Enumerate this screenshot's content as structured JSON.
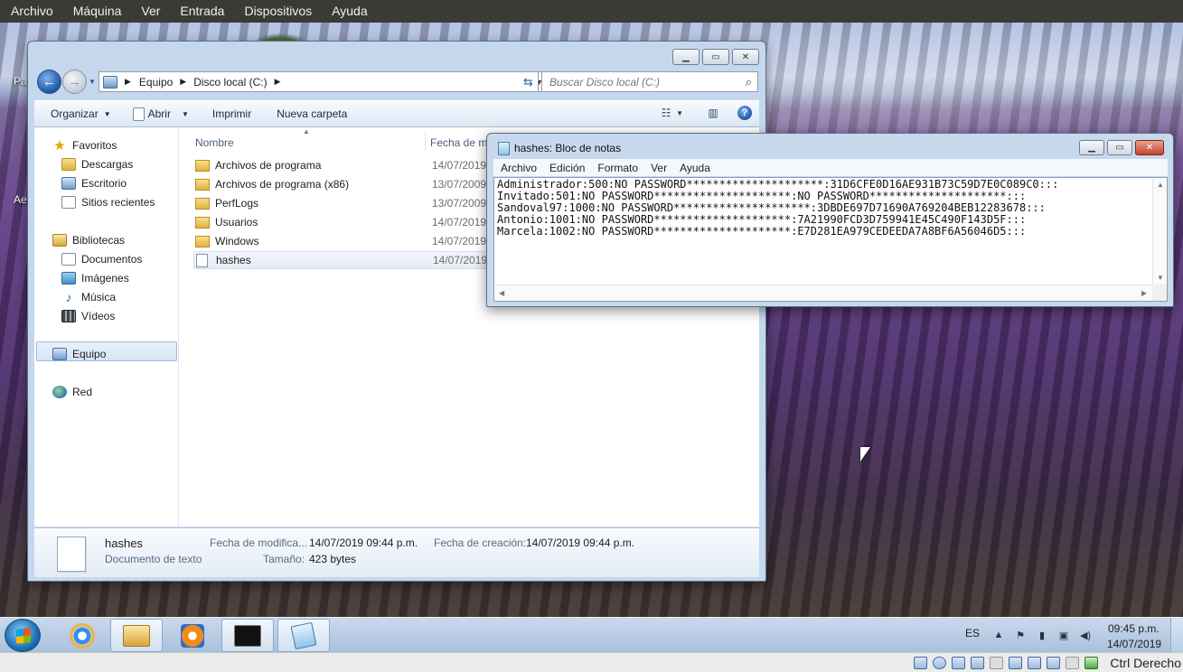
{
  "vbox": {
    "menu": [
      "Archivo",
      "Máquina",
      "Ver",
      "Entrada",
      "Dispositivos",
      "Ayuda"
    ],
    "host_key": "Ctrl Derecho"
  },
  "desktop": {
    "icon_fragments": [
      "Pa",
      "Aer"
    ]
  },
  "explorer": {
    "breadcrumb": [
      "Equipo",
      "Disco local (C:)"
    ],
    "search_placeholder": "Buscar Disco local (C:)",
    "toolbar": {
      "organize": "Organizar",
      "open": "Abrir",
      "print": "Imprimir",
      "new_folder": "Nueva carpeta"
    },
    "nav": {
      "favorites": "Favoritos",
      "downloads": "Descargas",
      "desktop": "Escritorio",
      "recent": "Sitios recientes",
      "libraries": "Bibliotecas",
      "documents": "Documentos",
      "images": "Imágenes",
      "music": "Música",
      "videos": "Vídeos",
      "computer": "Equipo",
      "network": "Red"
    },
    "columns": {
      "name": "Nombre",
      "date": "Fecha de m"
    },
    "files": [
      {
        "name": "Archivos de programa",
        "date": "14/07/2019 0",
        "type": "folder"
      },
      {
        "name": "Archivos de programa (x86)",
        "date": "13/07/2009 0",
        "type": "folder"
      },
      {
        "name": "PerfLogs",
        "date": "13/07/2009 0",
        "type": "folder"
      },
      {
        "name": "Usuarios",
        "date": "14/07/2019 0",
        "type": "folder"
      },
      {
        "name": "Windows",
        "date": "14/07/2019 0",
        "type": "folder"
      },
      {
        "name": "hashes",
        "date": "14/07/2019 0",
        "type": "text"
      }
    ],
    "details": {
      "name": "hashes",
      "type": "Documento de texto",
      "modified_label": "Fecha de modifica...",
      "modified_value": "14/07/2019 09:44 p.m.",
      "created_label": "Fecha de creación:",
      "created_value": "14/07/2019 09:44 p.m.",
      "size_label": "Tamaño:",
      "size_value": "423 bytes"
    }
  },
  "notepad": {
    "title": "hashes: Bloc de notas",
    "menu": [
      "Archivo",
      "Edición",
      "Formato",
      "Ver",
      "Ayuda"
    ],
    "lines": [
      "Administrador:500:NO PASSWORD*********************:31D6CFE0D16AE931B73C59D7E0C089C0:::",
      "Invitado:501:NO PASSWORD*********************:NO PASSWORD*********************:::",
      "Sandoval97:1000:NO PASSWORD*********************:3DBDE697D71690A769204BEB12283678:::",
      "Antonio:1001:NO PASSWORD*********************:7A21990FCD3D759941E45C490F143D5F:::",
      "Marcela:1002:NO PASSWORD*********************:E7D281EA979CEDEEDA7A8BF6A56046D5:::"
    ]
  },
  "taskbar": {
    "lang": "ES",
    "time": "09:45 p.m.",
    "date": "14/07/2019"
  }
}
